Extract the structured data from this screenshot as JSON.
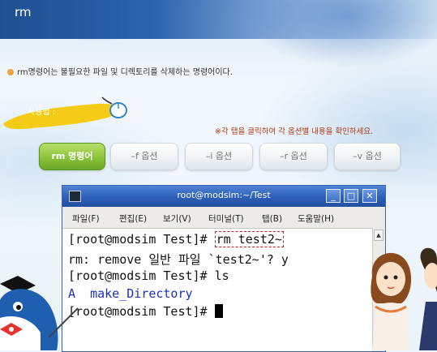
{
  "header": {
    "title": "rm"
  },
  "intro": {
    "text": "rm명령어는 불필요한 파일 및 디렉토리를 삭제하는 명령어이다."
  },
  "usage": {
    "label": "사용법 :"
  },
  "hint": {
    "text": "※각 탭을 클릭하여 각 옵션별 내용을 확인하세요."
  },
  "tabs": [
    {
      "label": "rm 명령어",
      "active": true
    },
    {
      "label": "–f 옵션",
      "active": false
    },
    {
      "label": "–i 옵션",
      "active": false
    },
    {
      "label": "–r 옵션",
      "active": false
    },
    {
      "label": "–v 옵션",
      "active": false
    }
  ],
  "terminal": {
    "title": "root@modsim:~/Test",
    "window_buttons": {
      "minimize": "_",
      "maximize": "□",
      "close": "✕"
    },
    "menu": [
      "파일(F)",
      "편집(E)",
      "보기(V)",
      "터미널(T)",
      "탭(B)",
      "도움말(H)"
    ],
    "lines": {
      "l1_prompt": "[root@modsim Test]#",
      "l1_command": "rm test2~",
      "l2": "rm: remove 일반 파일 `test2~'? y",
      "l3": "[root@modsim Test]# ls",
      "l4_a": "A",
      "l4_b": "make_Directory",
      "l5_prompt": "[root@modsim Test]#"
    }
  },
  "colors": {
    "header_bg": "#1f4f92",
    "active_tab": "#8cc23a",
    "hint_text": "#b23a12",
    "terminal_titlebar": "#2c5fb8",
    "highlight_box": "#d21b1b",
    "dir_color": "#1d2fc8"
  },
  "icons": [
    "mouse-icon",
    "terminal-app-icon",
    "minimize-icon",
    "maximize-icon",
    "close-icon",
    "scroll-up-icon",
    "scroll-down-icon"
  ]
}
